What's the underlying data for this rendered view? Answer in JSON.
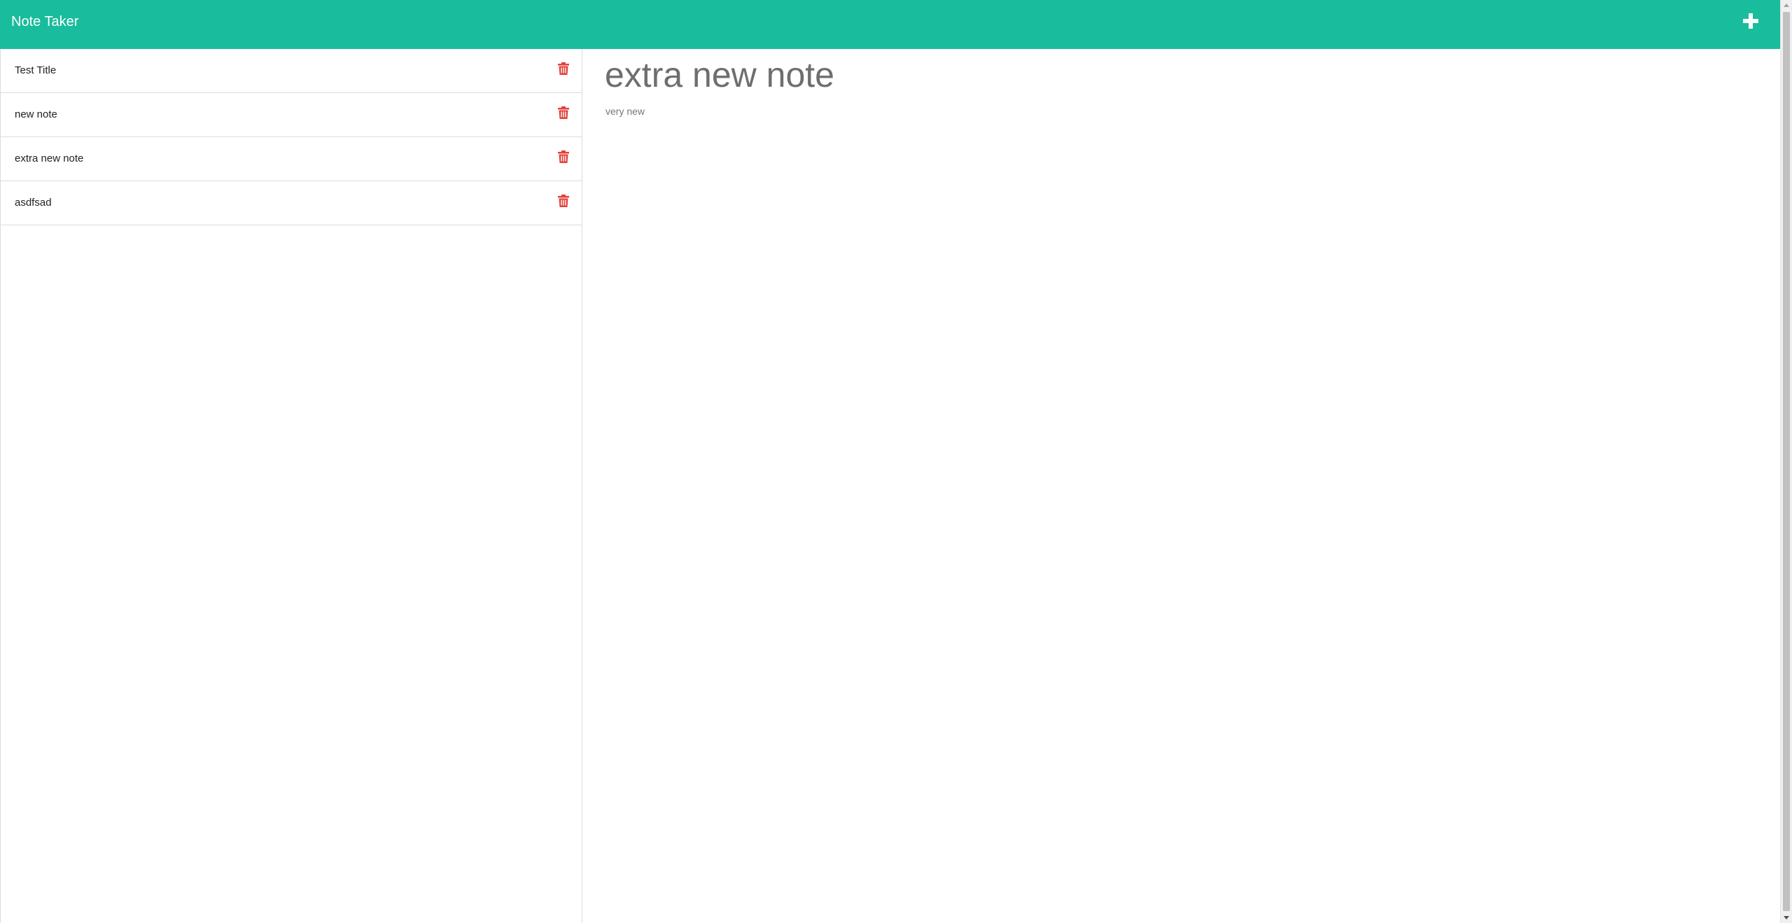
{
  "app": {
    "title": "Note Taker"
  },
  "colors": {
    "navbar": "#19bc9c",
    "delete": "#e5403a",
    "heading": "#6e6e6e"
  },
  "toolbar": {
    "add_icon": "plus-icon"
  },
  "notes": [
    {
      "title": "Test Title",
      "delete_icon": "trash-icon"
    },
    {
      "title": "new note",
      "delete_icon": "trash-icon"
    },
    {
      "title": "extra new note",
      "delete_icon": "trash-icon"
    },
    {
      "title": "asdfsad",
      "delete_icon": "trash-icon"
    }
  ],
  "active_note": {
    "title": "extra new note",
    "text": "very new"
  }
}
